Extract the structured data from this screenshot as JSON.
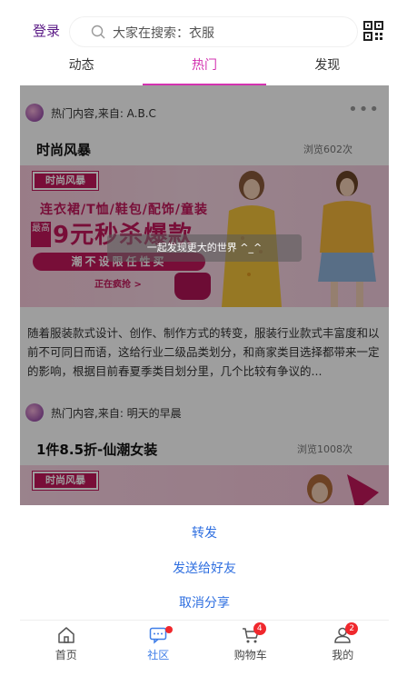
{
  "header": {
    "login_label": "登录",
    "search_placeholder": "大家在搜索：衣服",
    "qr_icon": "qr-code-icon",
    "search_icon": "search-icon"
  },
  "tabs": [
    {
      "label": "动态",
      "active": false
    },
    {
      "label": "热门",
      "active": true
    },
    {
      "label": "发现",
      "active": false
    }
  ],
  "posts": [
    {
      "source": "热门内容,来自: A.B.C",
      "title": "时尚风暴",
      "views": "浏览602次",
      "banner": {
        "brand": "时尚风暴",
        "categories": "连衣裙/T恤/鞋包/配饰/童装",
        "badge": "最高",
        "promo": "9元秒杀爆款",
        "slogan": "潮不设限任性买",
        "cta": "正在疯抢 >"
      },
      "text": "随着服装款式设计、创作、制作方式的转变，服装行业款式丰富度和以前不可同日而语，这给行业二级品类划分，和商家类目选择都带来一定的影响，根据目前春夏季类目划分里，几个比较有争议的..."
    },
    {
      "source": "热门内容,来自: 明天的早晨",
      "title": "1件8.5折-仙潮女装",
      "views": "浏览1008次",
      "banner": {
        "brand": "时尚风暴"
      }
    }
  ],
  "toast": "一起发现更大的世界 ^_^",
  "share_sheet": {
    "forward": "转发",
    "send_to_friend": "发送给好友",
    "cancel": "取消分享"
  },
  "bottom_nav": [
    {
      "label": "首页",
      "icon": "home-icon",
      "active": false
    },
    {
      "label": "社区",
      "icon": "community-icon",
      "active": true,
      "dot": true
    },
    {
      "label": "购物车",
      "icon": "cart-icon",
      "active": false,
      "badge": "4"
    },
    {
      "label": "我的",
      "icon": "profile-icon",
      "active": false,
      "badge": "2"
    }
  ],
  "colors": {
    "accent": "#d333b0",
    "link": "#2f6fe0",
    "nav_active": "#3f7ee8",
    "badge": "#f0282d",
    "brand": "#c2185b"
  }
}
